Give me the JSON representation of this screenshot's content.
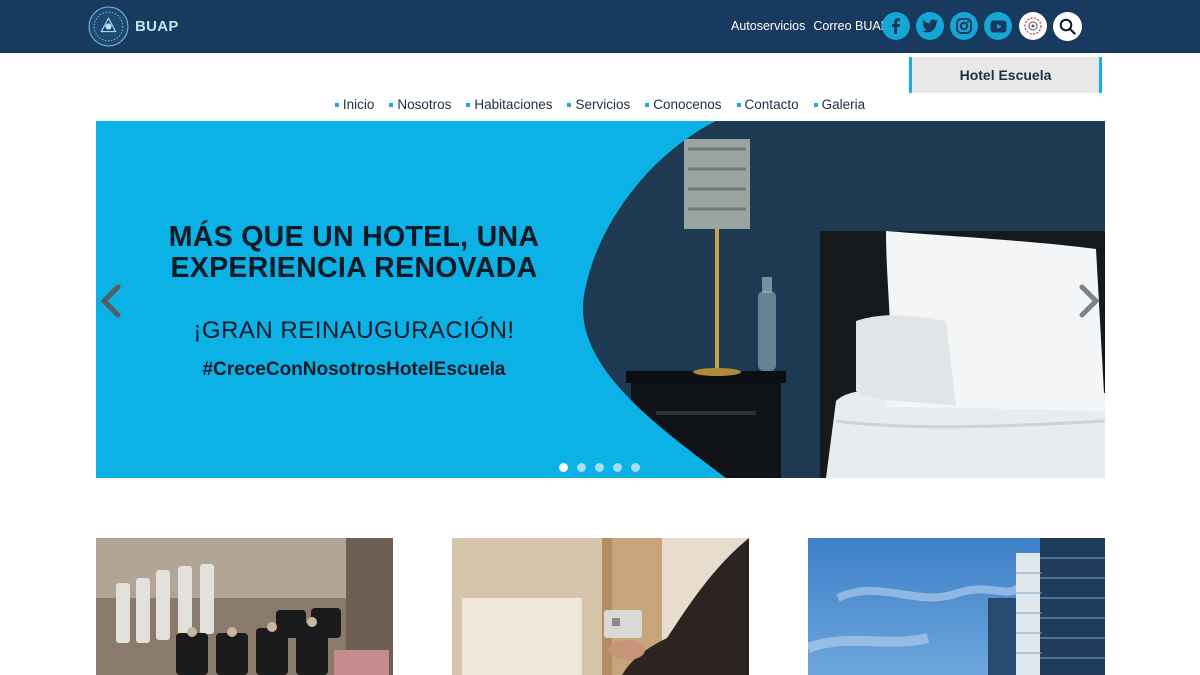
{
  "header": {
    "logo_text": "BUAP",
    "links": [
      "Autoservicios",
      "Correo BUAP"
    ],
    "social_icons": [
      "facebook-icon",
      "twitter-icon",
      "instagram-icon",
      "youtube-icon",
      "buap-emblem-icon",
      "search-icon"
    ],
    "colors": {
      "bar": "#173a5e",
      "accent": "#15a6d6"
    }
  },
  "section_tab": {
    "label": "Hotel Escuela"
  },
  "nav": {
    "items": [
      "Inicio",
      "Nosotros",
      "Habitaciones",
      "Servicios",
      "Conocenos",
      "Contacto",
      "Galeria"
    ]
  },
  "slider": {
    "headline_line1": "MÁS QUE UN HOTEL, UNA",
    "headline_line2": "EXPERIENCIA RENOVADA",
    "subheadline": "¡GRAN REINAUGURACIÓN!",
    "hashtag": "#CreceConNosotrosHotelEscuela",
    "slide_count": 5,
    "active_slide": 1,
    "background_color": "#0cb1e6"
  },
  "cards": [
    {
      "image": "bottles-amenities-photo"
    },
    {
      "image": "hotel-door-keycard-photo"
    },
    {
      "image": "building-sky-photo"
    }
  ]
}
